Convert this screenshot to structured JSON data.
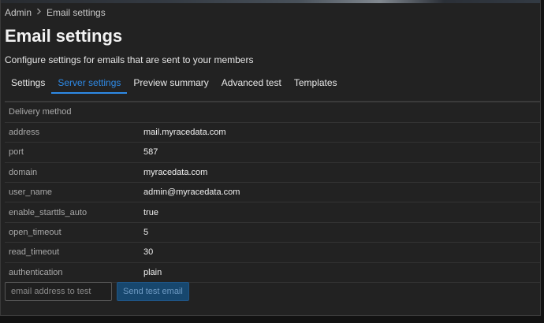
{
  "breadcrumb": {
    "root": "Admin",
    "current": "Email settings"
  },
  "page": {
    "title": "Email settings",
    "subtitle": "Configure settings for emails that are sent to your members"
  },
  "tabs": [
    {
      "label": "Settings",
      "active": false
    },
    {
      "label": "Server settings",
      "active": true
    },
    {
      "label": "Preview summary",
      "active": false
    },
    {
      "label": "Advanced test",
      "active": false
    },
    {
      "label": "Templates",
      "active": false
    }
  ],
  "delivery": {
    "section_label": "Delivery method",
    "rows": [
      {
        "key": "address",
        "value": "mail.myracedata.com"
      },
      {
        "key": "port",
        "value": "587"
      },
      {
        "key": "domain",
        "value": "myracedata.com"
      },
      {
        "key": "user_name",
        "value": "admin@myracedata.com"
      },
      {
        "key": "enable_starttls_auto",
        "value": "true"
      },
      {
        "key": "open_timeout",
        "value": "5"
      },
      {
        "key": "read_timeout",
        "value": "30"
      },
      {
        "key": "authentication",
        "value": "plain"
      }
    ]
  },
  "test_email": {
    "placeholder": "email address to test",
    "value": "",
    "button_label": "Send test email"
  },
  "icons": {
    "breadcrumb_separator": "chevron-right-icon"
  },
  "colors": {
    "accent": "#2e8ae6",
    "background": "#222222",
    "button_bg": "#17476e"
  }
}
